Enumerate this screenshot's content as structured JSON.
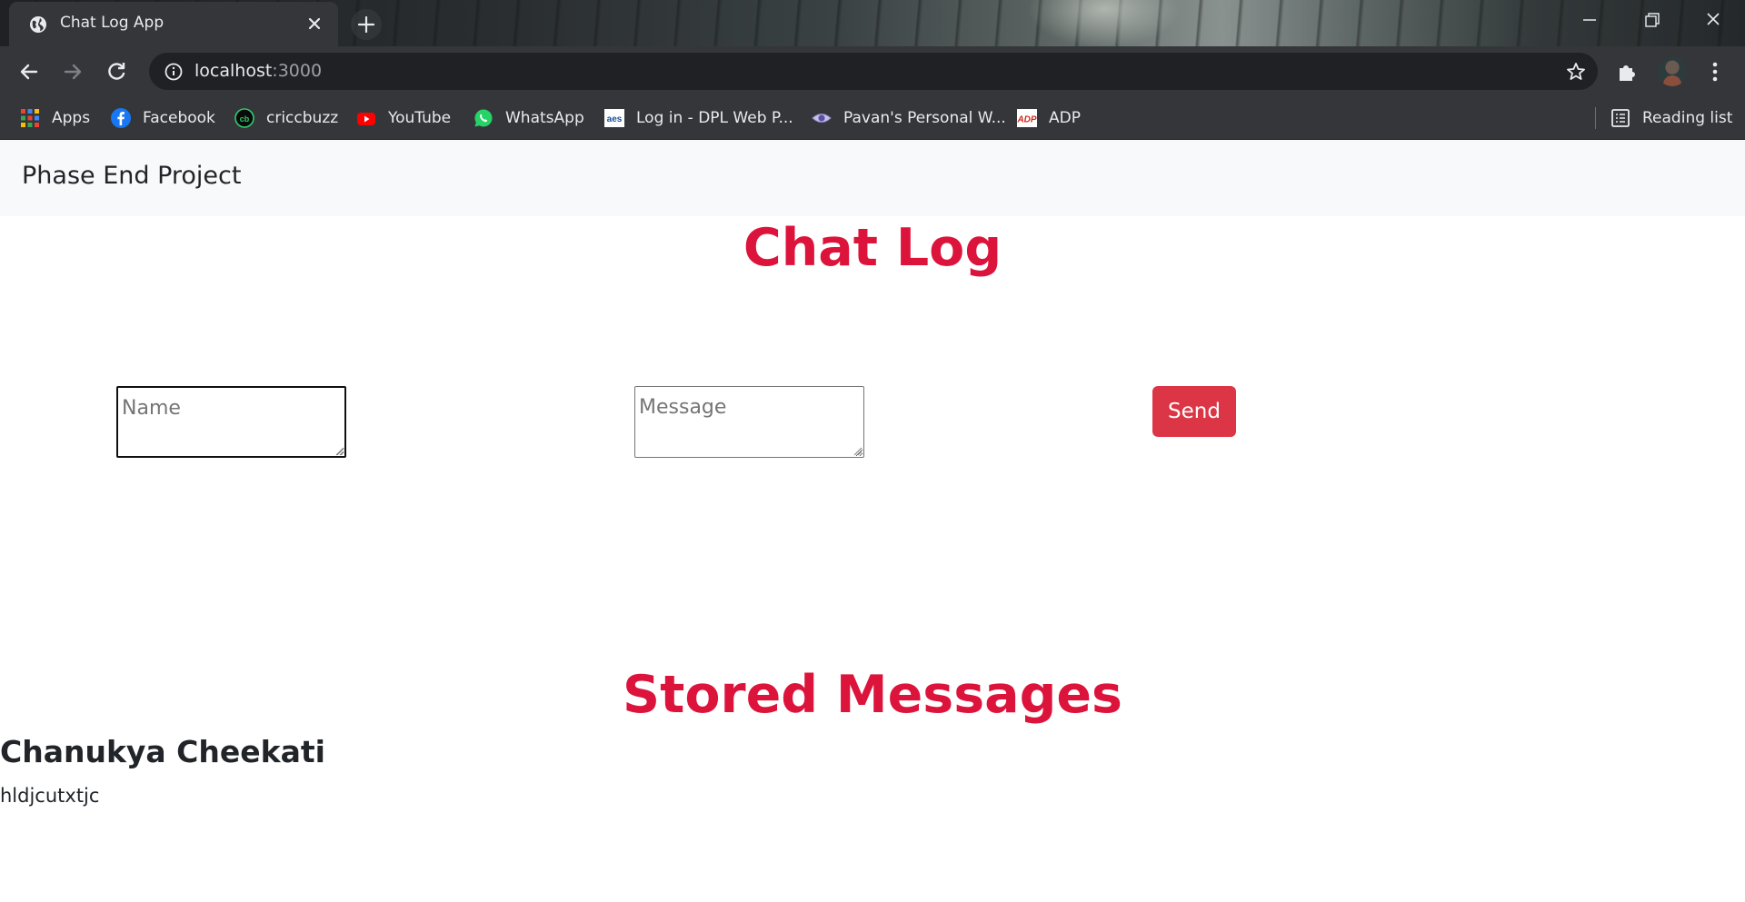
{
  "browser": {
    "tab": {
      "title": "Chat Log App",
      "favicon": "globe-icon"
    },
    "address": {
      "host": "localhost",
      "port": ":3000"
    },
    "bookmarks": [
      {
        "label": "Apps",
        "icon": "apps-grid-icon"
      },
      {
        "label": "Facebook",
        "icon": "facebook-icon"
      },
      {
        "label": "criccbuzz",
        "icon": "cricbuzz-icon"
      },
      {
        "label": "YouTube",
        "icon": "youtube-icon"
      },
      {
        "label": "WhatsApp",
        "icon": "whatsapp-icon"
      },
      {
        "label": "Log in - DPL Web P...",
        "icon": "aes-icon"
      },
      {
        "label": "Pavan's Personal W...",
        "icon": "eye-icon"
      },
      {
        "label": "ADP",
        "icon": "adp-icon"
      }
    ],
    "reading_list": {
      "label": "Reading list",
      "icon": "reading-list-icon"
    }
  },
  "navbar": {
    "brand": "Phase End Project"
  },
  "chat_form": {
    "heading": "Chat Log",
    "name_placeholder": "Name",
    "message_placeholder": "Message",
    "send_label": "Send"
  },
  "stored": {
    "heading": "Stored Messages",
    "messages": [
      {
        "name": "Chanukya Cheekati",
        "text": "hldjcutxtjc"
      }
    ]
  },
  "colors": {
    "heading": "#dc143c",
    "send_button": "#dc3545",
    "navbar_bg": "#f8f9fa"
  }
}
